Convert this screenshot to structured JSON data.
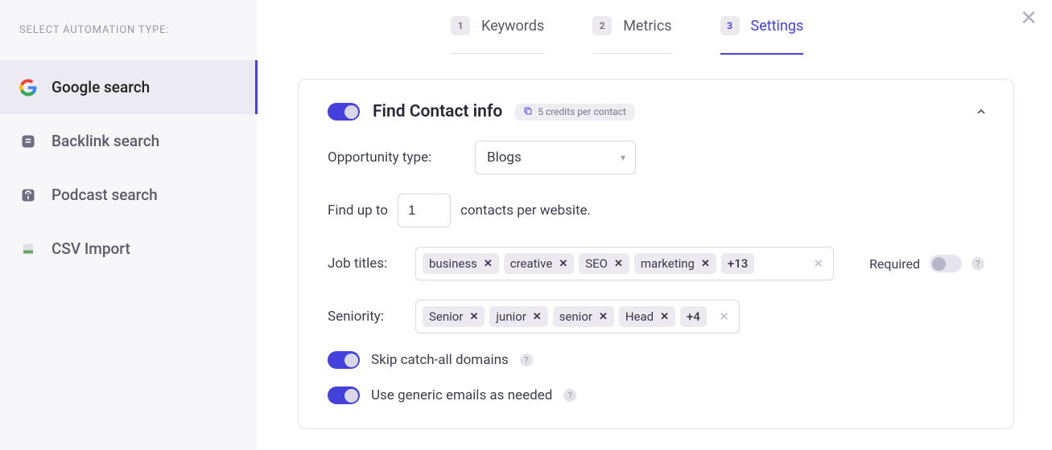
{
  "sidebar": {
    "title": "SELECT AUTOMATION TYPE:",
    "items": [
      {
        "label": "Google search",
        "active": true
      },
      {
        "label": "Backlink search",
        "active": false
      },
      {
        "label": "Podcast search",
        "active": false
      },
      {
        "label": "CSV Import",
        "active": false
      }
    ]
  },
  "tabs": [
    {
      "num": "1",
      "label": "Keywords",
      "active": false
    },
    {
      "num": "2",
      "label": "Metrics",
      "active": false
    },
    {
      "num": "3",
      "label": "Settings",
      "active": true
    }
  ],
  "card": {
    "title": "Find Contact info",
    "badge": "5 credits per contact",
    "opportunity_label": "Opportunity type:",
    "opportunity_value": "Blogs",
    "findupto_prefix": "Find up to",
    "findupto_value": "1",
    "findupto_suffix": "contacts per website.",
    "jobtitles_label": "Job titles:",
    "jobtitles": [
      "business",
      "creative",
      "SEO",
      "marketing"
    ],
    "jobtitles_more": "+13",
    "required_label": "Required",
    "seniority_label": "Seniority:",
    "seniority": [
      "Senior",
      "junior",
      "senior",
      "Head"
    ],
    "seniority_more": "+4",
    "skip_catchall_label": "Skip catch-all domains",
    "generic_emails_label": "Use generic emails as needed"
  }
}
